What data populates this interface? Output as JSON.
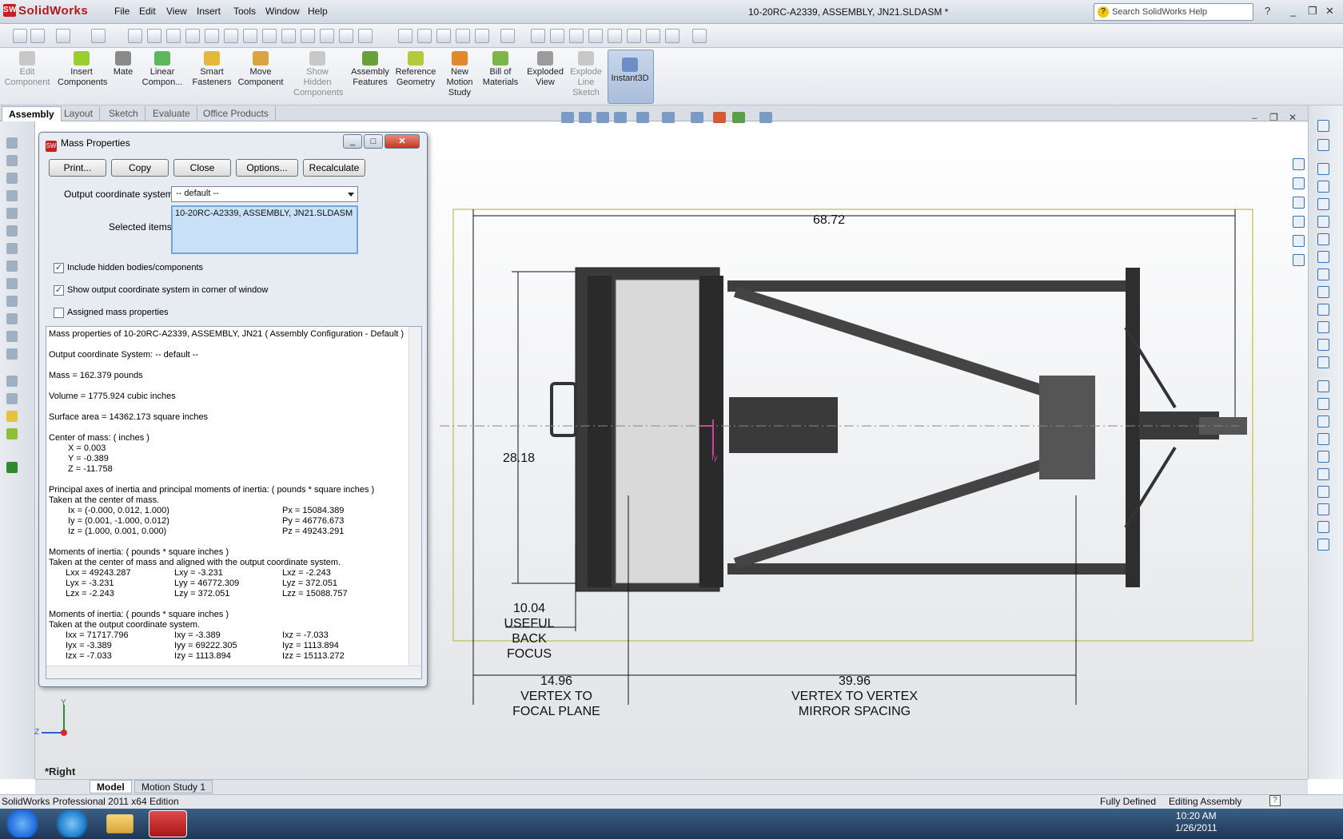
{
  "app": {
    "name": "SolidWorks",
    "document_title": "10-20RC-A2339, ASSEMBLY, JN21.SLDASM *",
    "help_search_placeholder": "Search SolidWorks Help"
  },
  "menu": [
    "File",
    "Edit",
    "View",
    "Insert",
    "Tools",
    "Window",
    "Help"
  ],
  "command_manager": [
    {
      "label": "Edit\nComponent",
      "enabled": false
    },
    {
      "label": "Insert\nComponents",
      "enabled": true
    },
    {
      "label": "Mate",
      "enabled": true
    },
    {
      "label": "Linear\nCompon...",
      "enabled": true
    },
    {
      "label": "Smart\nFasteners",
      "enabled": true
    },
    {
      "label": "Move\nComponent",
      "enabled": true
    },
    {
      "label": "Show\nHidden\nComponents",
      "enabled": false
    },
    {
      "label": "Assembly\nFeatures",
      "enabled": true
    },
    {
      "label": "Reference\nGeometry",
      "enabled": true
    },
    {
      "label": "New\nMotion\nStudy",
      "enabled": true
    },
    {
      "label": "Bill of\nMaterials",
      "enabled": true
    },
    {
      "label": "Exploded\nView",
      "enabled": true
    },
    {
      "label": "Explode\nLine\nSketch",
      "enabled": false
    },
    {
      "label": "Instant3D",
      "enabled": true,
      "active": true
    }
  ],
  "tabs": [
    "Assembly",
    "Layout",
    "Sketch",
    "Evaluate",
    "Office Products"
  ],
  "dialog": {
    "title": "Mass Properties",
    "buttons": [
      "Print...",
      "Copy",
      "Close",
      "Options...",
      "Recalculate"
    ],
    "output_coord_label": "Output coordinate system:",
    "output_coord_value": "-- default --",
    "selected_items_label": "Selected items:",
    "selected_items_value": "10-20RC-A2339, ASSEMBLY, JN21.SLDASM",
    "checkboxes": [
      {
        "label": "Include hidden bodies/components",
        "checked": true
      },
      {
        "label": "Show output coordinate system in corner of window",
        "checked": true
      },
      {
        "label": "Assigned mass properties",
        "checked": false
      }
    ],
    "output": {
      "header": "Mass properties of 10-20RC-A2339, ASSEMBLY, JN21 ( Assembly Configuration - Default )",
      "coord": "Output  coordinate System: -- default --",
      "mass": "Mass = 162.379 pounds",
      "volume": "Volume = 1775.924 cubic inches",
      "surface": "Surface area = 14362.173 square inches",
      "com_title": "Center of mass: ( inches )",
      "com_x": "X = 0.003",
      "com_y": "Y = -0.389",
      "com_z": "Z = -11.758",
      "pa_title": "Principal axes of inertia and principal moments of inertia: ( pounds * square inches )",
      "pa_sub": "Taken at the center of mass.",
      "ix": "Ix = (-0.000, 0.012, 1.000)",
      "iy": "Iy = (0.001, -1.000, 0.012)",
      "iz": "Iz = (1.000, 0.001, 0.000)",
      "px": "Px = 15084.389",
      "py": "Py = 46776.673",
      "pz": "Pz = 49243.291",
      "mi1_title": "Moments of inertia: ( pounds * square inches )",
      "mi1_sub": "Taken at the center of mass and aligned with the output coordinate system.",
      "lxx": "Lxx = 49243.287",
      "lxy": "Lxy = -3.231",
      "lxz": "Lxz = -2.243",
      "lyx": "Lyx = -3.231",
      "lyy": "Lyy = 46772.309",
      "lyz": "Lyz = 372.051",
      "lzx": "Lzx = -2.243",
      "lzy": "Lzy = 372.051",
      "lzz": "Lzz = 15088.757",
      "mi2_title": "Moments of inertia: ( pounds * square inches )",
      "mi2_sub": "Taken at the output coordinate system.",
      "ixx": "Ixx = 71717.796",
      "ixy": "Ixy = -3.389",
      "ixz": "Ixz = -7.033",
      "iyx": "Iyx = -3.389",
      "iyy": "Iyy = 69222.305",
      "iyz": "Iyz = 1113.894",
      "izx": "Izx = -7.033",
      "izy": "Izy = 1113.894",
      "izz": "Izz = 15113.272"
    }
  },
  "drawing": {
    "dim_top": "68.72",
    "dim_height": "28.18",
    "dim_back_focus": "10.04\nUSEFUL\nBACK\nFOCUS",
    "dim_vertex_focal": "14.96\nVERTEX TO\nFOCAL PLANE",
    "dim_vertex_vertex": "39.96\nVERTEX TO VERTEX\nMIRROR SPACING",
    "axis_label": "Iy"
  },
  "triad": {
    "y": "Y",
    "z": "Z"
  },
  "view_label": "*Right",
  "model_tabs": [
    "Model",
    "Motion Study 1"
  ],
  "status": {
    "left": "SolidWorks Professional 2011 x64 Edition",
    "state": "Fully Defined",
    "mode": "Editing Assembly"
  },
  "taskbar": {
    "time": "10:20 AM",
    "date": "1/26/2011"
  }
}
